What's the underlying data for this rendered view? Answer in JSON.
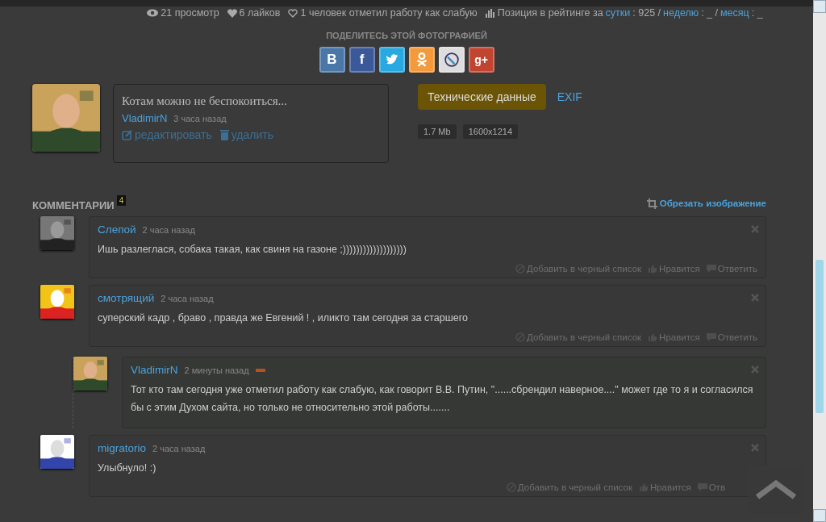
{
  "stats": {
    "views": "21 просмотр",
    "likes": "6 лайков",
    "weak": "1 человек отметил работу как слабую",
    "rating": [
      {
        "kind": "text",
        "text": "Позиция в рейтинге за"
      },
      {
        "kind": "link",
        "text": "сутки"
      },
      {
        "kind": "text",
        "text": ": 925 /"
      },
      {
        "kind": "link",
        "text": "неделю"
      },
      {
        "kind": "text",
        "text": ": _ /"
      },
      {
        "kind": "link",
        "text": "месяц"
      },
      {
        "kind": "text",
        "text": ": _"
      }
    ]
  },
  "share": {
    "title": "ПОДЕЛИТЕСЬ ЭТОЙ ФОТОГРАФИЕЙ",
    "buttons": [
      {
        "kind": "vk",
        "label": "В"
      },
      {
        "kind": "fb",
        "label": "f"
      },
      {
        "kind": "tw"
      },
      {
        "kind": "ok"
      },
      {
        "kind": "lj"
      },
      {
        "kind": "gp",
        "label": "g+"
      }
    ]
  },
  "post": {
    "title": "Котам можно не беспокоиться...",
    "author": "VladimirN",
    "time": "3 часа назад",
    "edit": "редактировать",
    "delete": "удалить"
  },
  "tech": {
    "button": "Технические данные",
    "exif": "EXIF",
    "tags": [
      "1.7 Mb",
      "1600x1214"
    ]
  },
  "comments_header": {
    "title": "КОММЕНТАРИИ",
    "count": "4",
    "crop": "Обрезать изображение"
  },
  "comments": [
    {
      "author": "Слепой",
      "time": "2 часа назад",
      "badge": false,
      "text": "Ишь разлеглася, собака такая, как свиня на газоне ;)))))))))))))))))))",
      "actions": [
        "Добавить в черный список",
        "Нравится",
        "Ответить"
      ]
    },
    {
      "author": "смотрящий",
      "time": "2 часа назад",
      "badge": false,
      "text": "суперский кадр , браво , правда же Евгений ! , иликто там сегодня за старшего",
      "actions": [
        "Добавить в черный список",
        "Нравится",
        "Ответить"
      ],
      "children": [
        {
          "author": "VladimirN",
          "time": "2 минуты назад",
          "badge": true,
          "text": "Тот кто там сегодня уже отметил работу как слабую, как говорит В.В. Путин, \"......сбрендил наверное....\" может где то я и согласился бы с этим Духом сайта, но только не относительно этой работы......."
        }
      ]
    },
    {
      "author": "migratorio",
      "time": "2 часа назад",
      "badge": false,
      "text": "Улыбнуло! :)",
      "actions": [
        "Добавить в черный список",
        "Нравится",
        "Отв"
      ]
    }
  ]
}
